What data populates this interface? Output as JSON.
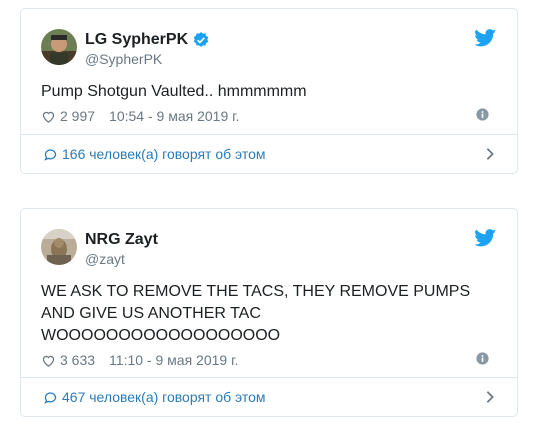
{
  "tweets": [
    {
      "name": "LG SypherPK",
      "handle": "@SypherPK",
      "verified": true,
      "text": "Pump Shotgun Vaulted.. hmmmmmm",
      "likes": "2 997",
      "timestamp": "10:54 - 9 мая 2019 г.",
      "discussion": "166 человек(а) говорят об этом",
      "avatar_icon": "person-avatar-icon",
      "colors": {
        "avatar_bg": "#6b7f52"
      }
    },
    {
      "name": "NRG Zayt",
      "handle": "@zayt",
      "verified": false,
      "text": "WE ASK TO REMOVE THE TACS, THEY REMOVE PUMPS AND GIVE US ANOTHER TAC WOOOOOOOOOOOOOOOOOO",
      "likes": "3 633",
      "timestamp": "11:10 - 9 мая 2019 г.",
      "discussion": "467 человек(а) говорят об этом",
      "avatar_icon": "person-avatar-icon",
      "colors": {
        "avatar_bg": "#b9ad97"
      }
    }
  ],
  "colors": {
    "text": "#1c2022",
    "muted": "#697882",
    "link": "#2b7bb9",
    "twitter_blue": "#1da1f2",
    "border": "#e1e8ed"
  }
}
